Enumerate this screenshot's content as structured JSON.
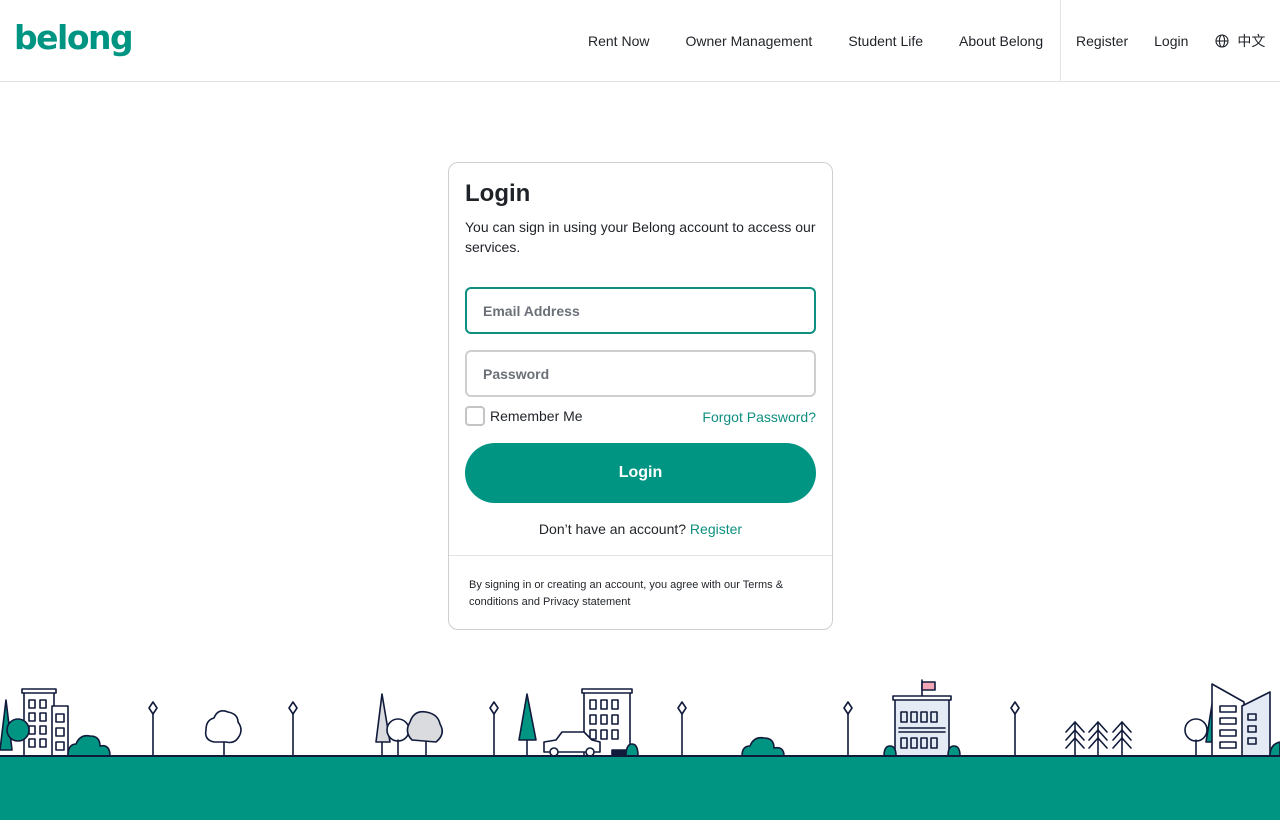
{
  "brand": {
    "logo_text": "belong",
    "accent_color": "#009583"
  },
  "nav": {
    "main_items": [
      {
        "label": "Rent Now"
      },
      {
        "label": "Owner Management"
      },
      {
        "label": "Student Life"
      },
      {
        "label": "About Belong"
      }
    ],
    "register_label": "Register",
    "login_label": "Login",
    "language_icon": "globe-icon",
    "language_label": "中文"
  },
  "login_card": {
    "title": "Login",
    "description": "You can sign in using your Belong account to access our services.",
    "email_placeholder": "Email Address",
    "email_value": "",
    "password_placeholder": "Password",
    "password_value": "",
    "remember_me_label": "Remember Me",
    "remember_me_checked": false,
    "forgot_password_label": "Forgot Password?",
    "login_button_label": "Login",
    "no_account_text": "Don’t have an account?",
    "register_link_label": "Register",
    "legal_text": "By signing in or creating an account, you agree with our Terms & conditions and Privacy statement"
  },
  "footer": {
    "illustration": "city-skyline-illustration",
    "ground_color": "#009583"
  }
}
